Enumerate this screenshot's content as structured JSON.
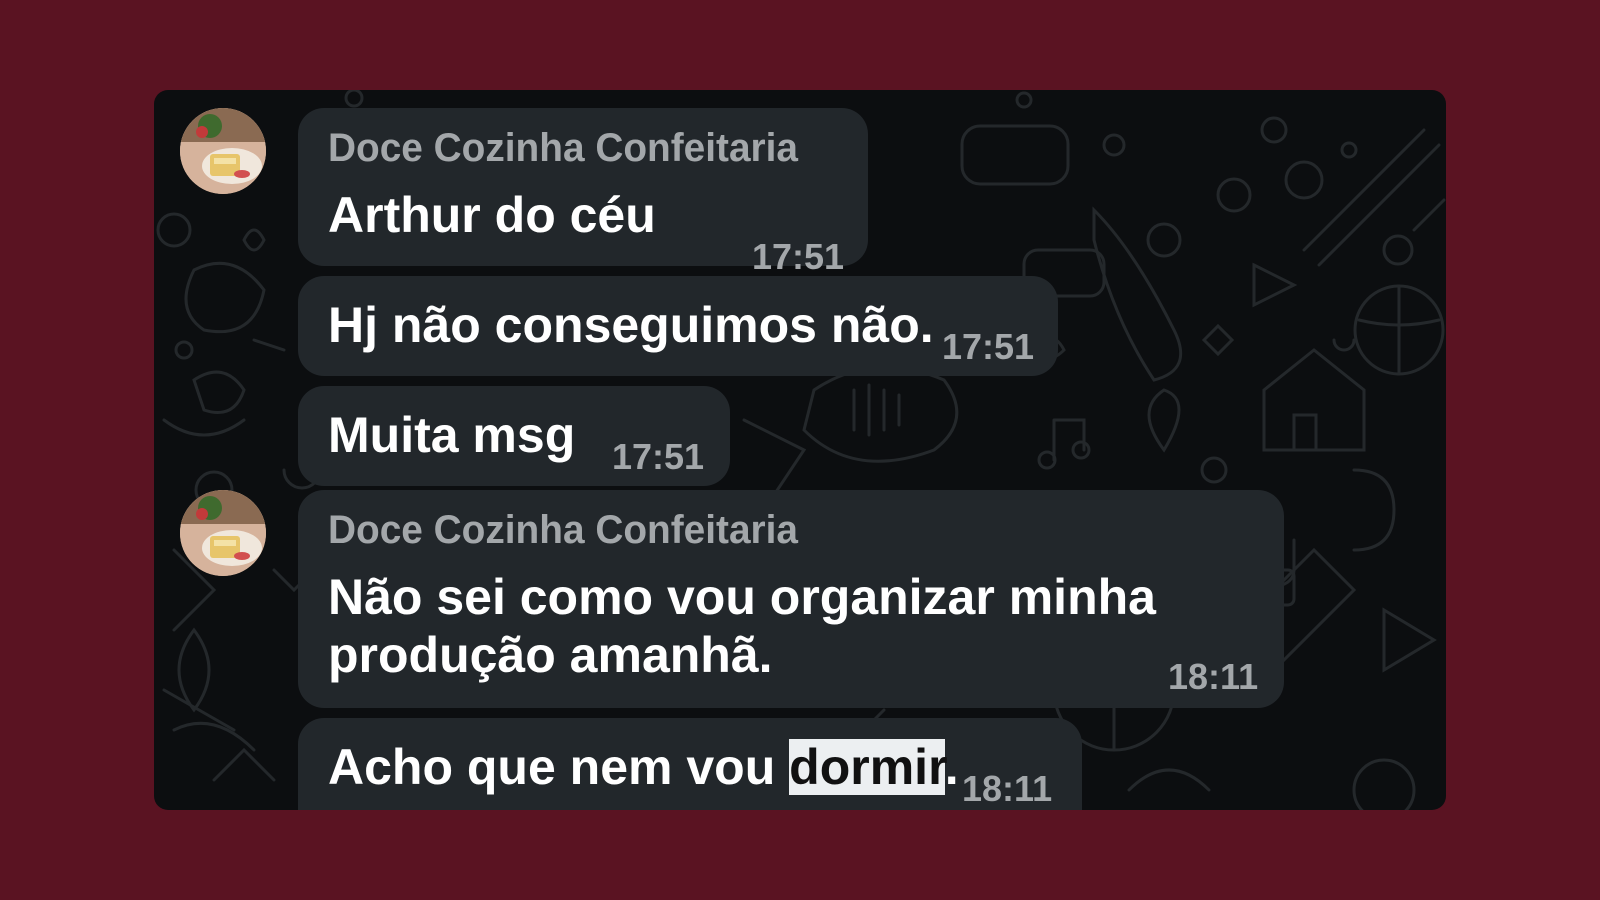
{
  "chat": {
    "messages": [
      {
        "sender": "Doce Cozinha Confeitaria",
        "text": "Arthur do céu",
        "time": "17:51"
      },
      {
        "text": "Hj não conseguimos não.",
        "time": "17:51"
      },
      {
        "text": "Muita msg",
        "time": "17:51"
      },
      {
        "sender": "Doce Cozinha Confeitaria",
        "text_line1": "Não sei como vou organizar minha",
        "text_line2": "produção amanhã.",
        "time": "18:11"
      },
      {
        "text_before": "Acho que nem vou ",
        "text_highlight": "dormir",
        "text_after": ".",
        "time": "18:11"
      }
    ]
  },
  "colors": {
    "page_background": "#5a1322",
    "chat_background": "#0c0e10",
    "bubble": "#22272b",
    "message_text": "#ffffff",
    "meta_text": "#a3a7aa",
    "selection_highlight": "#eceff1"
  }
}
